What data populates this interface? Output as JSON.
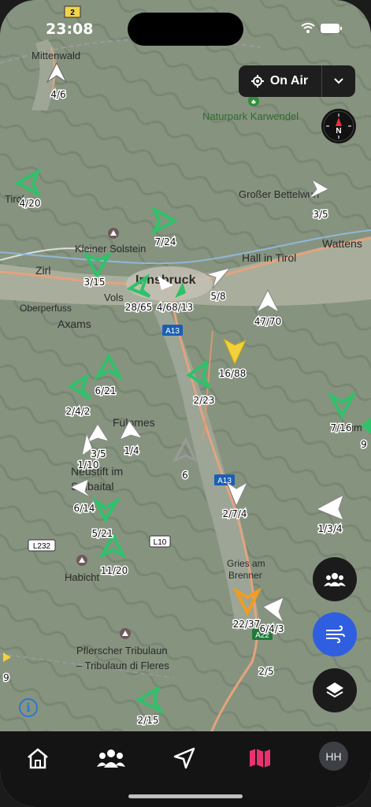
{
  "status": {
    "time": "23:08"
  },
  "onair": {
    "label": "On Air"
  },
  "compass": {
    "north": "N"
  },
  "info_icon": "i",
  "road_signs": [
    "2",
    "A13",
    "A13",
    "L232",
    "L10",
    "A22"
  ],
  "places": [
    "Mittenwald",
    "Naturpark Karwendel",
    "Großer Bettelwurf",
    "Tirol",
    "Kleiner Solstein",
    "Hall in Tirol",
    "Wattens",
    "Zirl",
    "Innsbruck",
    "Vols",
    "Oberperfuss",
    "Axams",
    "Fulpmes",
    "Neustift im",
    "Stubaital",
    "Habicht",
    "Gries am",
    "Brenner",
    "Pflerscher Tribulaun",
    "– Tribulaun di Fleres",
    "Lizum"
  ],
  "aircraft_labels": [
    "4/6",
    "4/20",
    "7/24",
    "3/5",
    "3/15",
    "28/65",
    "4/68/13",
    "5/8",
    "47/70",
    "16/88",
    "6/21",
    "2/4/2",
    "2/23",
    "7/16",
    "3/5",
    "1/4",
    "1/10",
    "6",
    "6/14",
    "2/7/4",
    "1/3/4",
    "5/21",
    "11/20",
    "22/37",
    "6/4/3",
    "2/5",
    "2/15",
    "9",
    "9"
  ],
  "fab": {
    "group": "group-icon",
    "wind": "wind-icon",
    "layers": "layers-icon"
  },
  "user": {
    "initials": "HH"
  },
  "tabs": [
    "home-icon",
    "pilots-icon",
    "navigate-icon",
    "map-icon"
  ],
  "colors": {
    "active_tab": "#e8336f",
    "wind_fab": "#2f5fe0",
    "glider_green": "#2ec26a",
    "glider_yellow": "#f3d13a",
    "glider_orange": "#f29c1f"
  }
}
